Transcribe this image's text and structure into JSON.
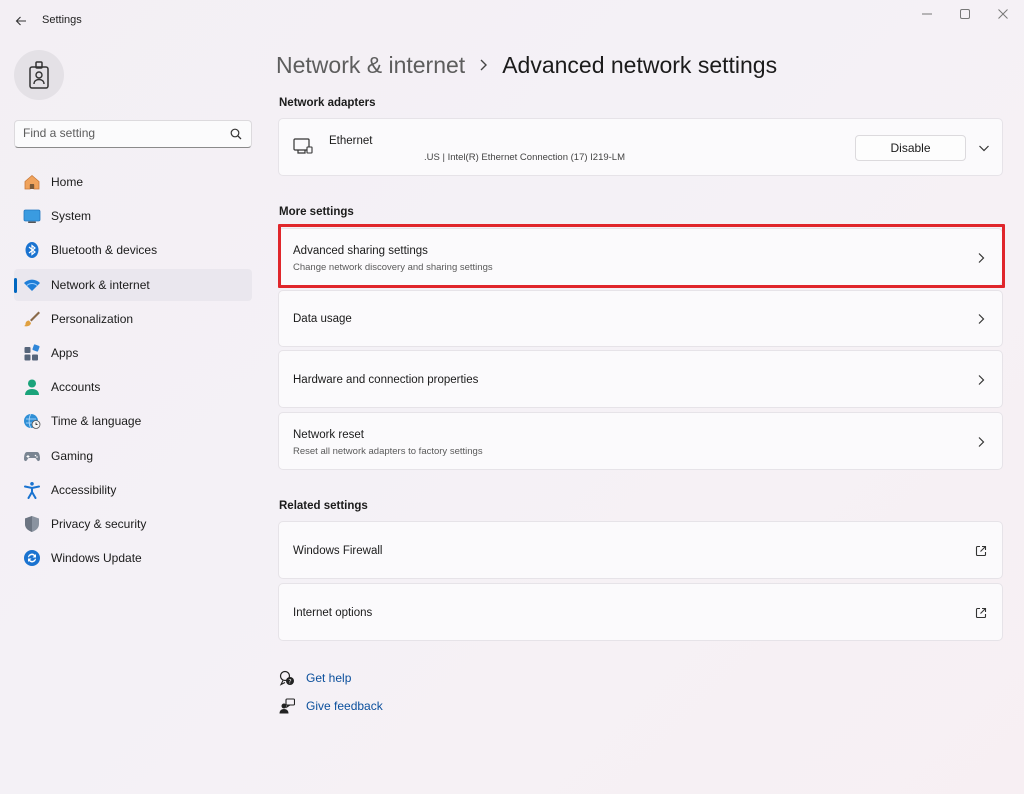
{
  "window": {
    "title": "Settings"
  },
  "search": {
    "placeholder": "Find a setting"
  },
  "sidebar": {
    "items": [
      {
        "label": "Home",
        "icon": "home-icon"
      },
      {
        "label": "System",
        "icon": "system-icon"
      },
      {
        "label": "Bluetooth & devices",
        "icon": "bluetooth-icon"
      },
      {
        "label": "Network & internet",
        "icon": "wifi-icon",
        "active": true
      },
      {
        "label": "Personalization",
        "icon": "brush-icon"
      },
      {
        "label": "Apps",
        "icon": "apps-icon"
      },
      {
        "label": "Accounts",
        "icon": "person-icon"
      },
      {
        "label": "Time & language",
        "icon": "globe-clock-icon"
      },
      {
        "label": "Gaming",
        "icon": "gamepad-icon"
      },
      {
        "label": "Accessibility",
        "icon": "accessibility-icon"
      },
      {
        "label": "Privacy & security",
        "icon": "shield-icon"
      },
      {
        "label": "Windows Update",
        "icon": "update-icon"
      }
    ]
  },
  "breadcrumb": {
    "parent": "Network & internet",
    "current": "Advanced network settings"
  },
  "network_adapters": {
    "section_title": "Network adapters",
    "adapter": {
      "name": "Ethernet",
      "description": ".US | Intel(R) Ethernet Connection (17) I219-LM",
      "button_label": "Disable"
    }
  },
  "more_settings": {
    "section_title": "More settings",
    "items": [
      {
        "title": "Advanced sharing settings",
        "subtitle": "Change network discovery and sharing settings"
      },
      {
        "title": "Data usage",
        "subtitle": ""
      },
      {
        "title": "Hardware and connection properties",
        "subtitle": ""
      },
      {
        "title": "Network reset",
        "subtitle": "Reset all network adapters to factory settings"
      }
    ]
  },
  "related_settings": {
    "section_title": "Related settings",
    "items": [
      {
        "title": "Windows Firewall"
      },
      {
        "title": "Internet options"
      }
    ]
  },
  "help": {
    "get_help": "Get help",
    "give_feedback": "Give feedback"
  },
  "colors": {
    "accent": "#0067c0",
    "highlight_box": "#e0262b",
    "link": "#0a4f9c"
  }
}
